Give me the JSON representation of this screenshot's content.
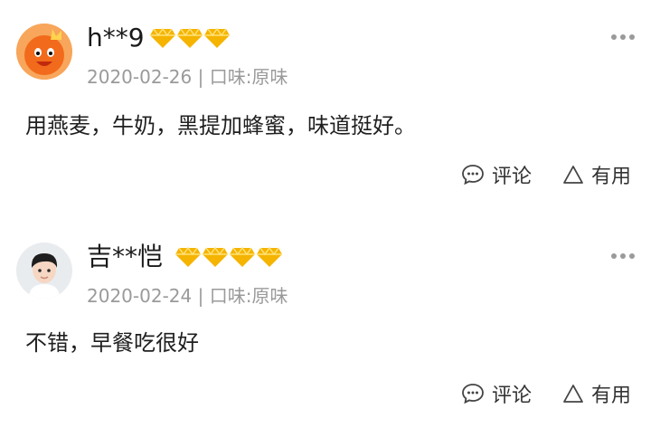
{
  "reviews": [
    {
      "username": "h**9",
      "badge_count": 3,
      "date": "2020-02-26",
      "separator": "|",
      "flavor": "口味:原味",
      "content": "用燕麦，牛奶，黑提加蜂蜜，味道挺好。",
      "comment_label": "评论",
      "useful_label": "有用",
      "avatar_icon": "crown-mascot-avatar"
    },
    {
      "username": "吉**恺",
      "badge_count": 4,
      "date": "2020-02-24",
      "separator": "|",
      "flavor": "口味:原味",
      "content": "不错，早餐吃很好",
      "comment_label": "评论",
      "useful_label": "有用",
      "avatar_icon": "boy-avatar"
    }
  ],
  "colors": {
    "badge_gold": "#f5b400",
    "meta_gray": "#9a9a9a",
    "avatar_orange": "#f26a1b"
  }
}
